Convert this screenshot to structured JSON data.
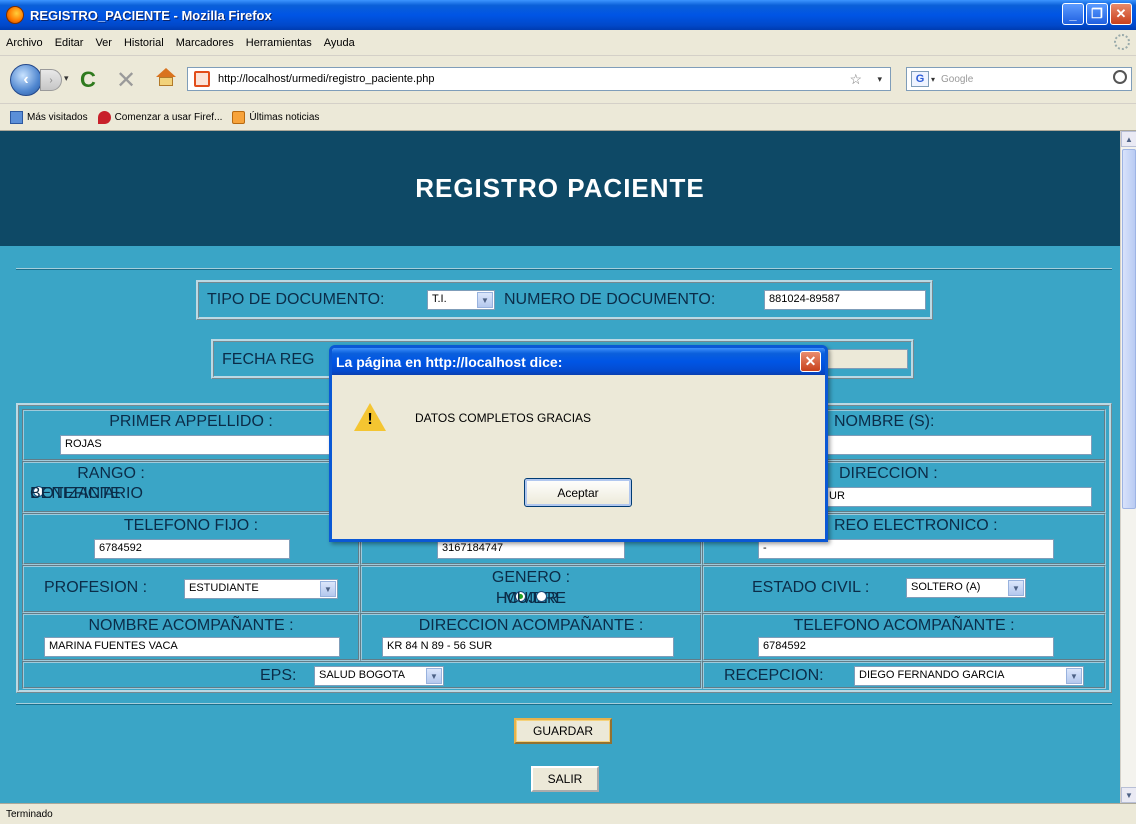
{
  "window": {
    "title": "REGISTRO_PACIENTE - Mozilla Firefox"
  },
  "menu": [
    "Archivo",
    "Editar",
    "Ver",
    "Historial",
    "Marcadores",
    "Herramientas",
    "Ayuda"
  ],
  "nav": {
    "url": "http://localhost/urmedi/registro_paciente.php",
    "search_placeholder": "Google"
  },
  "bookmarks": [
    "Más visitados",
    "Comenzar a usar Firef...",
    "Últimas noticias"
  ],
  "page": {
    "title": "REGISTRO PACIENTE",
    "tipo_doc_label": "TIPO DE DOCUMENTO:",
    "tipo_doc_value": "T.I.",
    "num_doc_label": "NUMERO DE DOCUMENTO:",
    "num_doc_value": "881024-89587",
    "fecha_label": "FECHA REG",
    "primer_apellido_label": "PRIMER APPELLIDO :",
    "primer_apellido_value": "ROJAS",
    "nombre_label": "NOMBRE (S):",
    "rango_label": "RANGO :",
    "cotizante_label": "COTIZANTE",
    "beneficiario_label": "BENEFICIARIO",
    "direccion_label": "DIRECCION :",
    "direccion_value": "UR",
    "telefono_fijo_label": "TELEFONO FIJO :",
    "telefono_fijo_value": "6784592",
    "celular_value": "3167184747",
    "correo_label": "REO ELECTRONICO :",
    "correo_value": "-",
    "profesion_label": "PROFESION :",
    "profesion_value": "ESTUDIANTE",
    "genero_label": "GENERO :",
    "hombre_label": "HOMBRE",
    "mujer_label": "MUJER",
    "estado_civil_label": "ESTADO CIVIL :",
    "estado_civil_value": "SOLTERO (A)",
    "nombre_acomp_label": "NOMBRE ACOMPAÑANTE :",
    "nombre_acomp_value": "MARINA FUENTES VACA",
    "direccion_acomp_label": "DIRECCION ACOMPAÑANTE :",
    "direccion_acomp_value": "KR 84 N 89 - 56 SUR",
    "telefono_acomp_label": "TELEFONO ACOMPAÑANTE :",
    "telefono_acomp_value": "6784592",
    "eps_label": "EPS:",
    "eps_value": "SALUD BOGOTA",
    "recepcion_label": "RECEPCION:",
    "recepcion_value": "DIEGO FERNANDO GARCIA",
    "guardar_label": "GUARDAR",
    "salir_label": "SALIR"
  },
  "dialog": {
    "title": "La página en http://localhost dice:",
    "message": "DATOS COMPLETOS GRACIAS",
    "ok_label": "Aceptar"
  },
  "status": "Terminado"
}
